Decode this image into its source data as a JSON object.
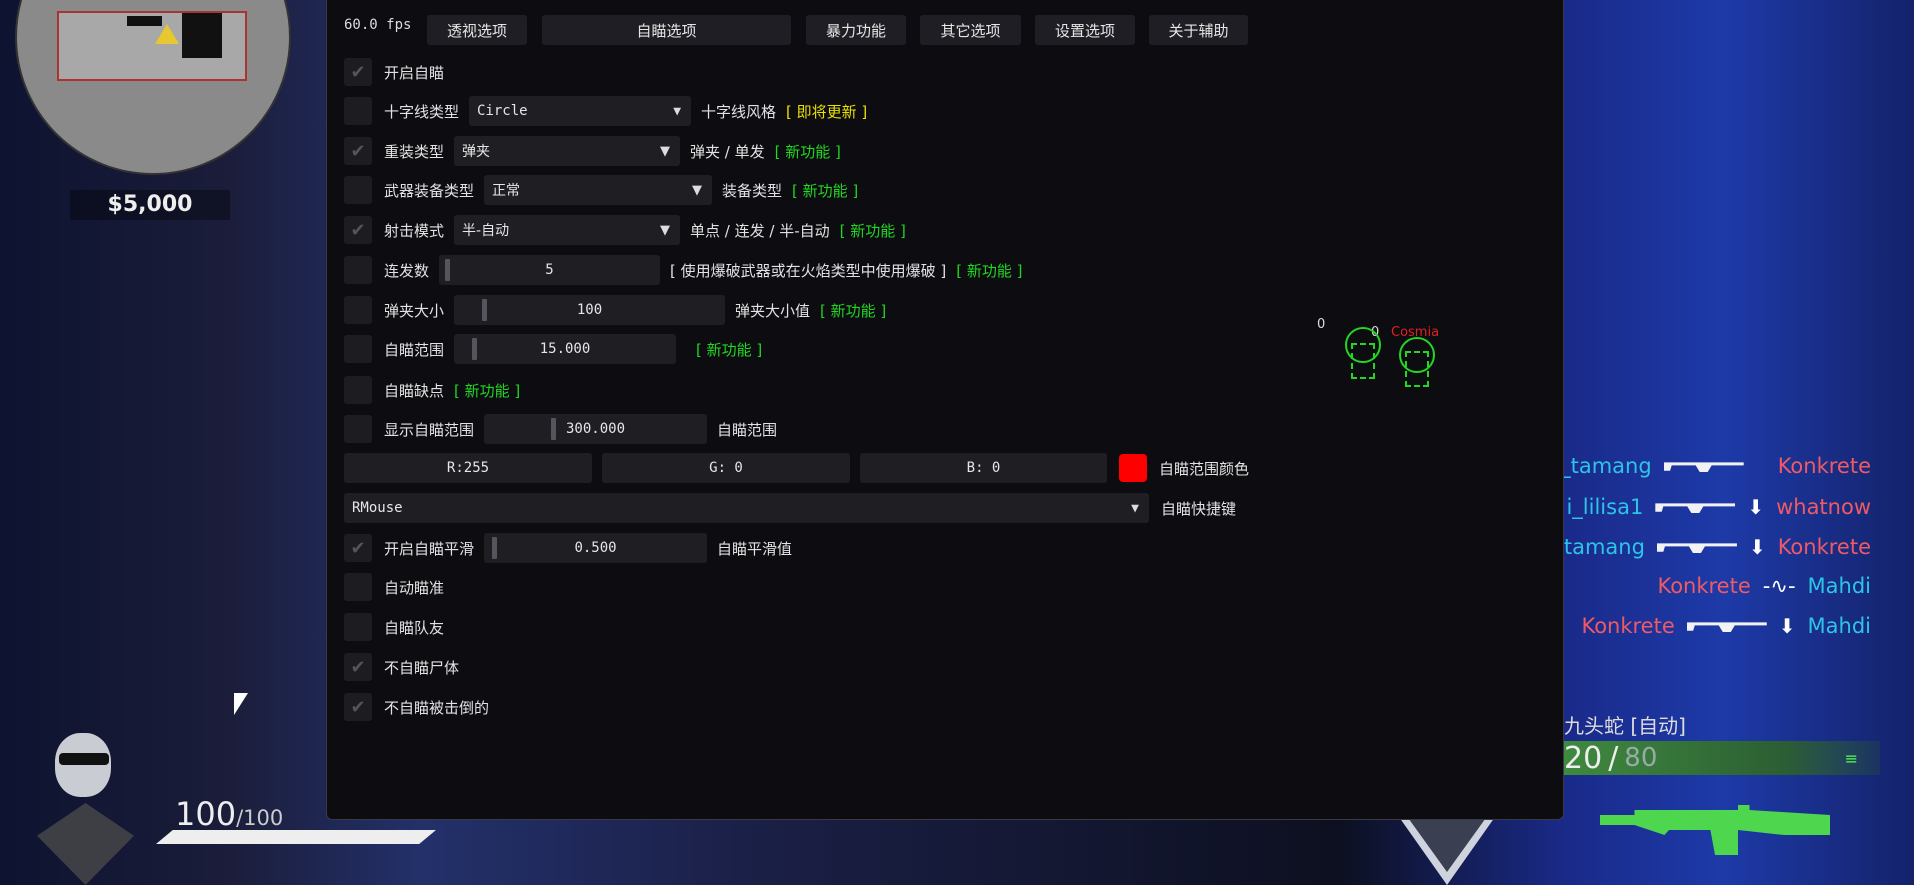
{
  "hud": {
    "money": "$5,000",
    "health": "100",
    "health_max": "/100",
    "weapon_name": "九头蛇 [自动]",
    "ammo": "20",
    "ammo_reserve": "80",
    "ammo_sep": "/"
  },
  "esp": {
    "left_num": "0",
    "right_num": "0",
    "right_name": "Cosmia",
    "color": "#22d622"
  },
  "killfeed": [
    {
      "killer": "esh_tamang",
      "killer_color": "cyan",
      "weapon": "rifle-icon",
      "headshot": false,
      "victim": "Konkrete",
      "victim_color": "red"
    },
    {
      "killer": "i_lilisa1",
      "killer_color": "cyan",
      "weapon": "rifle-icon",
      "headshot": true,
      "victim": "whatnow",
      "victim_color": "red"
    },
    {
      "killer": "_tamang",
      "killer_color": "cyan",
      "weapon": "rifle-icon",
      "headshot": true,
      "victim": "Konkrete",
      "victim_color": "red"
    },
    {
      "killer": "Konkrete",
      "killer_color": "red",
      "weapon": "heartbeat-icon",
      "headshot": false,
      "victim": "Mahdi",
      "victim_color": "cyan"
    },
    {
      "killer": "Konkrete",
      "killer_color": "red",
      "weapon": "shotgun-icon",
      "headshot": true,
      "victim": "Mahdi",
      "victim_color": "cyan"
    }
  ],
  "menu": {
    "fps": "60.0 fps",
    "tabs": [
      "透视选项",
      "自瞄选项",
      "暴力功能",
      "其它选项",
      "设置选项",
      "关于辅助"
    ],
    "active_tab": "自瞄选项",
    "new_tag": "[ 新功能 ]",
    "soon_tag": "[ 即将更新 ]",
    "enable_aim": {
      "label": "开启自瞄",
      "checked": true
    },
    "crosshair": {
      "label": "十字线类型",
      "value": "Circle",
      "after": "十字线风格",
      "checked": false
    },
    "reload": {
      "label": "重装类型",
      "value": "弹夹",
      "after": "弹夹 / 单发",
      "checked": true
    },
    "equip": {
      "label": "武器装备类型",
      "value": "正常",
      "after": "装备类型",
      "checked": false
    },
    "fire": {
      "label": "射击模式",
      "value": "半-自动",
      "after": "单点 / 连发 / 半-自动",
      "checked": true
    },
    "burst": {
      "label": "连发数",
      "value": "5",
      "after": "[ 使用爆破武器或在火焰类型中使用爆破 ]",
      "checked": false
    },
    "mag": {
      "label": "弹夹大小",
      "value": "100",
      "after": "弹夹大小值",
      "checked": false
    },
    "range": {
      "label": "自瞄范围",
      "value": "15.000",
      "checked": false
    },
    "weakness": {
      "label": "自瞄缺点",
      "checked": false
    },
    "show_range": {
      "label": "显示自瞄范围",
      "value": "300.000",
      "after": "自瞄范围",
      "checked": false
    },
    "color": {
      "r": "R:255",
      "g": "G:  0",
      "b": "B:  0",
      "swatch": "#ff0000",
      "label": "自瞄范围颜色"
    },
    "hotkey": {
      "value": "RMouse",
      "label": "自瞄快捷键"
    },
    "smooth": {
      "label": "开启自瞄平滑",
      "value": "0.500",
      "after": "自瞄平滑值",
      "checked": true
    },
    "auto_aim": {
      "label": "自动瞄准",
      "checked": false
    },
    "team": {
      "label": "自瞄队友",
      "checked": false
    },
    "no_corpse": {
      "label": "不自瞄尸体",
      "checked": true
    },
    "no_downed": {
      "label": "不自瞄被击倒的",
      "checked": true
    }
  }
}
